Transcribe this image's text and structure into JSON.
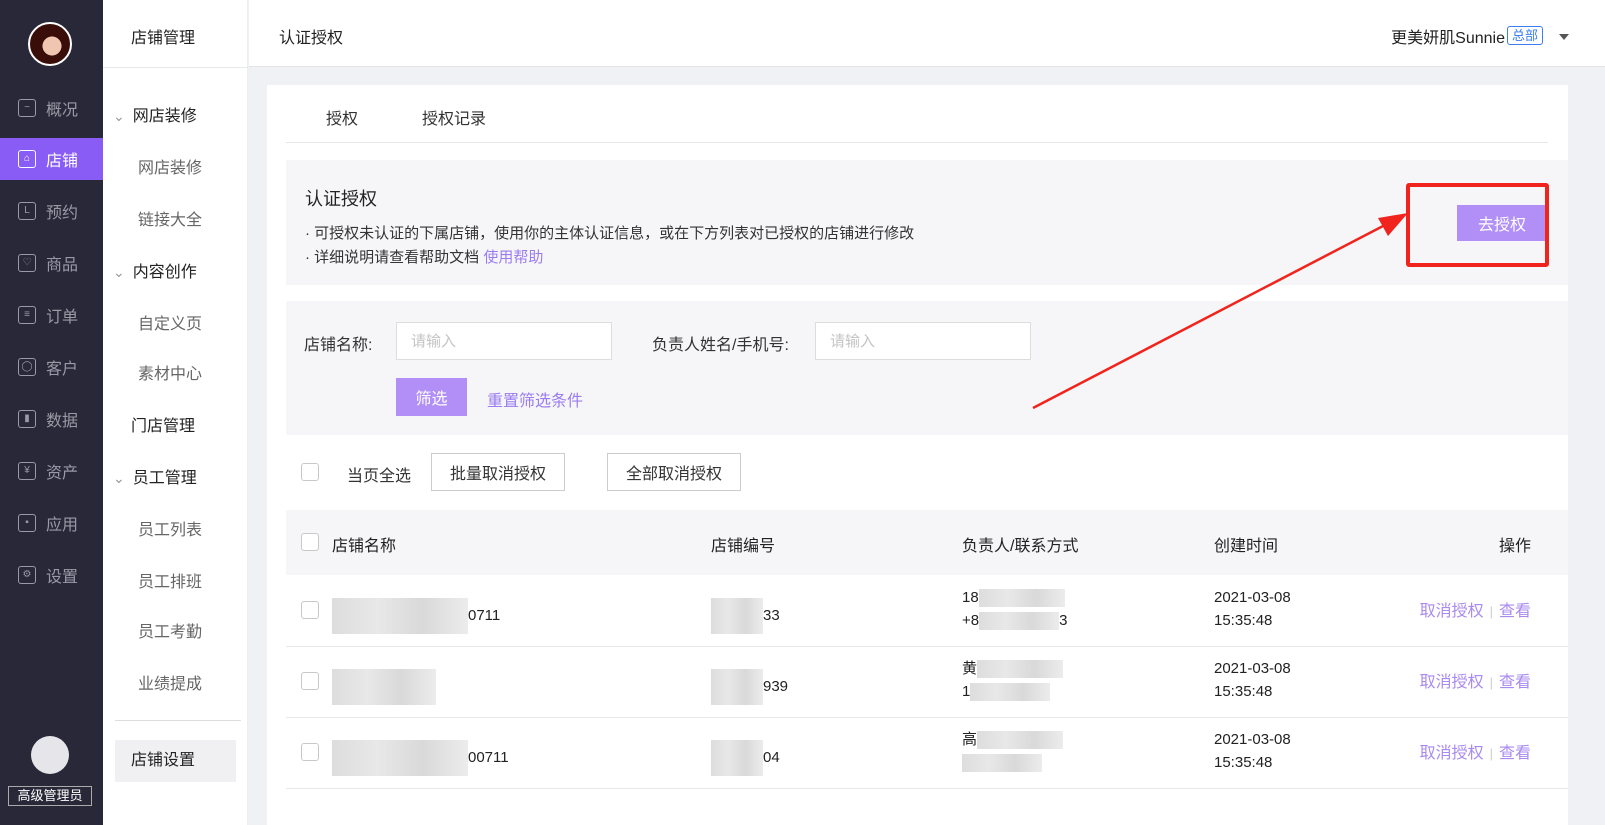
{
  "nav": {
    "items": [
      {
        "label": "概况",
        "icon": "monitor-icon"
      },
      {
        "label": "店铺",
        "icon": "store-icon",
        "active": true
      },
      {
        "label": "预约",
        "icon": "calendar-icon"
      },
      {
        "label": "商品",
        "icon": "bag-icon"
      },
      {
        "label": "订单",
        "icon": "list-icon"
      },
      {
        "label": "客户",
        "icon": "user-icon"
      },
      {
        "label": "数据",
        "icon": "bar-chart-icon"
      },
      {
        "label": "资产",
        "icon": "yen-icon"
      },
      {
        "label": "应用",
        "icon": "apps-icon"
      },
      {
        "label": "设置",
        "icon": "gear-icon"
      }
    ],
    "role": "高级管理员"
  },
  "sub": {
    "title": "店铺管理",
    "groups": [
      {
        "label": "网店装修",
        "items": [
          "网店装修",
          "链接大全"
        ]
      },
      {
        "label": "内容创作",
        "items": [
          "自定义页",
          "素材中心"
        ]
      },
      {
        "label": "门店管理"
      },
      {
        "label": "员工管理",
        "items": [
          "员工列表",
          "员工排班",
          "员工考勤",
          "业绩提成"
        ]
      }
    ],
    "bottom": "店铺设置"
  },
  "header": {
    "title": "认证授权",
    "user": "更美妍肌Sunnie",
    "badge": "总部"
  },
  "tabs": [
    "授权",
    "授权记录"
  ],
  "info": {
    "title": "认证授权",
    "line1": "· 可授权未认证的下属店铺，使用你的主体认证信息，或在下方列表对已授权的店铺进行修改",
    "line2": "· 详细说明请查看帮助文档",
    "help": "使用帮助",
    "button": "去授权"
  },
  "filter": {
    "name_label": "店铺名称:",
    "name_placeholder": "请输入",
    "owner_label": "负责人姓名/手机号:",
    "owner_placeholder": "请输入",
    "submit": "筛选",
    "reset": "重置筛选条件"
  },
  "bulk": {
    "select_all": "当页全选",
    "cancel_batch": "批量取消授权",
    "cancel_all": "全部取消授权"
  },
  "table": {
    "headers": [
      "店铺名称",
      "店铺编号",
      "负责人/联系方式",
      "创建时间",
      "操作"
    ],
    "rows": [
      {
        "name": "0711",
        "code": "33",
        "contact1": "18",
        "contact2": "+8",
        "contact3": "3",
        "date": "2021-03-08",
        "time": "15:35:48"
      },
      {
        "name": "",
        "code": "939",
        "contact1": "黄",
        "contact2": "1",
        "contact3": "",
        "date": "2021-03-08",
        "time": "15:35:48"
      },
      {
        "name": "00711",
        "code": "04",
        "contact1": "高",
        "contact2": "",
        "contact3": "",
        "date": "2021-03-08",
        "time": "15:35:48"
      }
    ],
    "action_cancel": "取消授权",
    "action_view": "查看"
  },
  "colors": {
    "accent": "#8a5cf6",
    "button": "#b18ff7",
    "annotation": "#f0241c"
  }
}
